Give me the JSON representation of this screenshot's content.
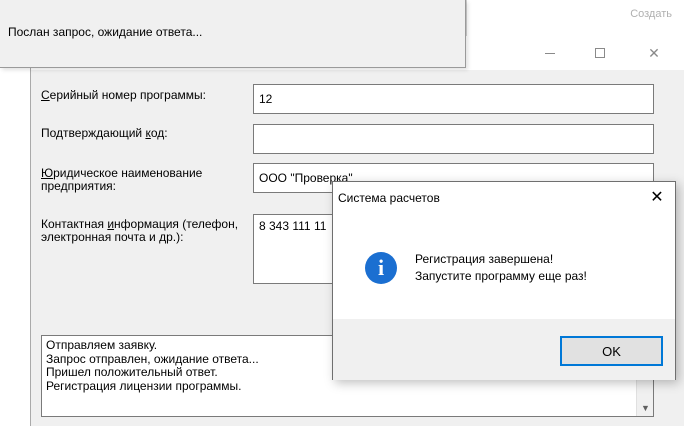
{
  "background_window": {
    "title_fragment": "Создать"
  },
  "status_popup": {
    "text": "Послан запрос, ожидание ответа..."
  },
  "main_window": {
    "fields": {
      "serial": {
        "label_prefix": "",
        "label_mnemonic": "С",
        "label_rest": "ерийный номер программы:",
        "value": "12"
      },
      "confirm": {
        "label_prefix": "Подтверждающий ",
        "label_mnemonic": "к",
        "label_rest": "од:",
        "value": ""
      },
      "company": {
        "label_prefix": "",
        "label_mnemonic": "Ю",
        "label_rest": "ридическое наименование предприятия:",
        "value": "ООО \"Проверка\""
      },
      "contact": {
        "label_prefix": "Контактная ",
        "label_mnemonic": "и",
        "label_rest": "нформация (телефон, электронная почта и др.):",
        "value": "8 343 111 11"
      }
    },
    "log_lines": [
      "Отправляем заявку.",
      "Запрос отправлен, ожидание ответа...",
      "Пришел положительный ответ.",
      "Регистрация лицензии программы."
    ]
  },
  "dialog": {
    "title": "Система расчетов",
    "icon": "info-icon",
    "message_line1": "Регистрация завершена!",
    "message_line2": "Запустите программу еще раз!",
    "ok_label": "OK",
    "accent_color": "#0078d7"
  }
}
